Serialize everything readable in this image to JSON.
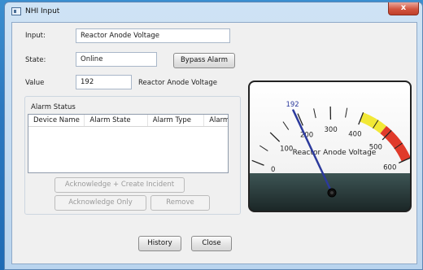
{
  "window": {
    "title": "NHI Input",
    "close_glyph": "x"
  },
  "form": {
    "input_label": "Input:",
    "input_value": "Reactor Anode Voltage",
    "state_label": "State:",
    "state_value": "Online",
    "bypass_label": "Bypass Alarm",
    "value_label": "Value",
    "value_value": "192",
    "value_caption": "Reactor Anode Voltage"
  },
  "alarm_status": {
    "title": "Alarm Status",
    "columns": [
      "Device Name",
      "Alarm State",
      "Alarm Type",
      "Alarm"
    ],
    "rows": [],
    "ack_incident_label": "Acknowledge + Create Incident",
    "ack_only_label": "Acknowledge Only",
    "remove_label": "Remove"
  },
  "footer": {
    "history_label": "History",
    "close_label": "Close"
  },
  "gauge": {
    "value": 192,
    "value_label": "192",
    "min": 0,
    "max": 600,
    "major_ticks": [
      "0",
      "100",
      "200",
      "300",
      "400",
      "500",
      "600"
    ],
    "caption": "Reactor Anode Voltage",
    "zones": [
      {
        "from": 400,
        "to": 480,
        "color": "#f2e836"
      },
      {
        "from": 480,
        "to": 600,
        "color": "#e03a2a"
      }
    ],
    "needle_color": "#2c3a9c"
  }
}
